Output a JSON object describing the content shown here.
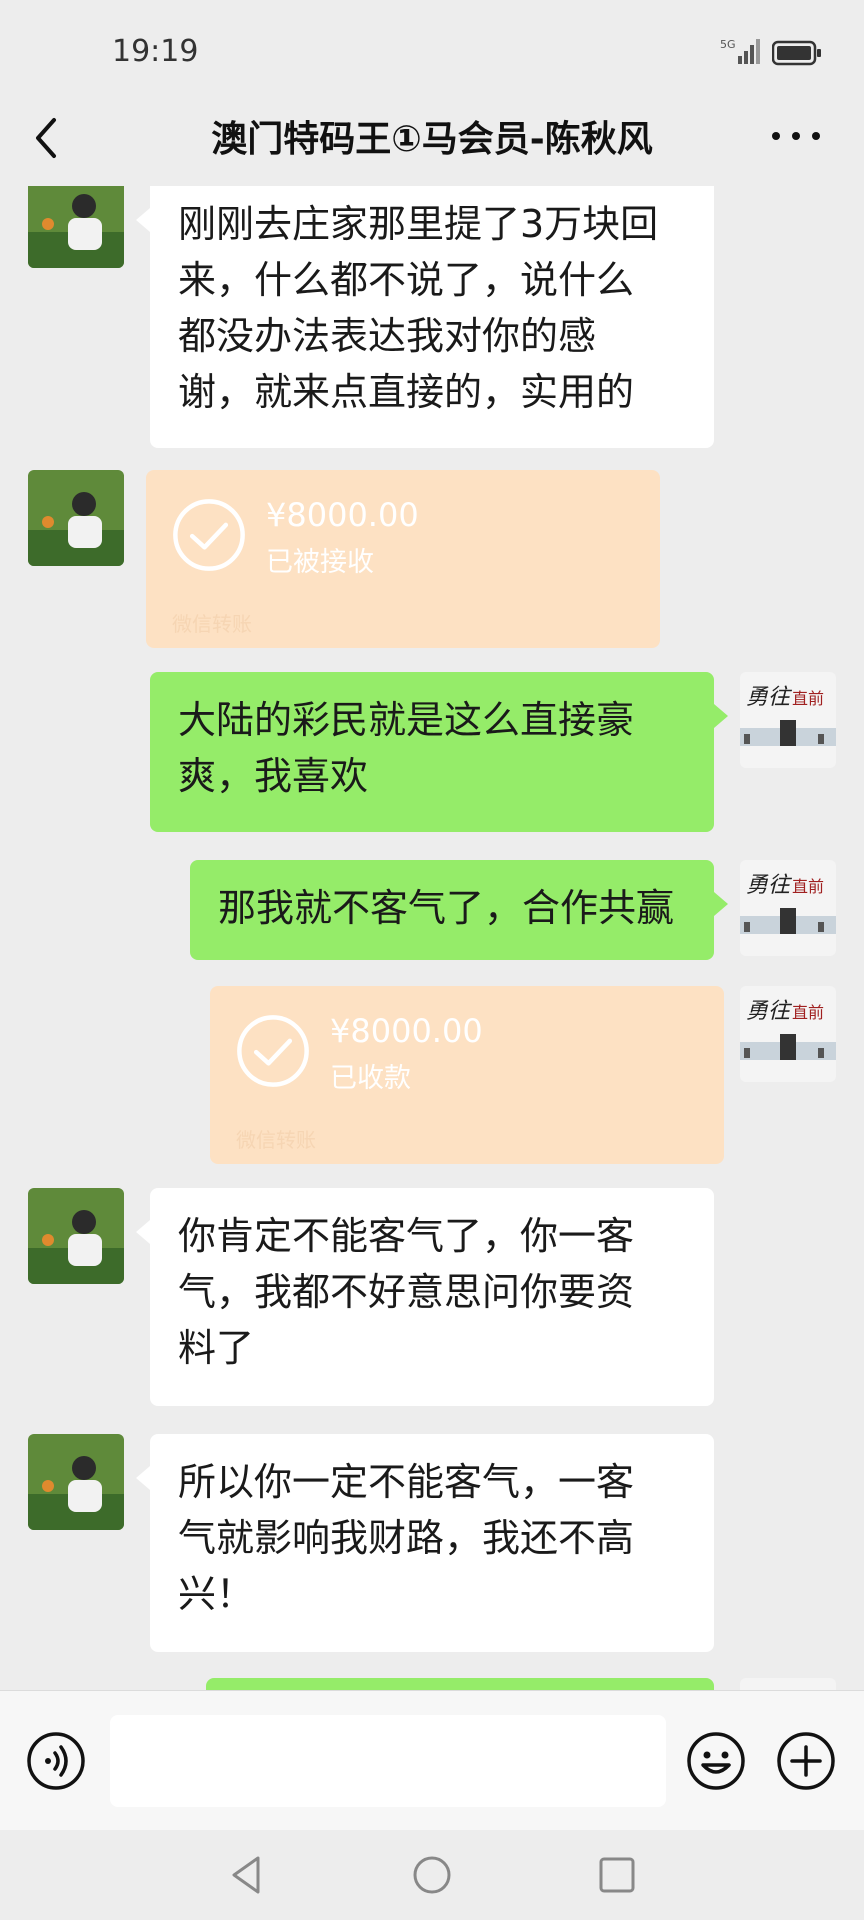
{
  "status_bar": {
    "time": "19:19",
    "network": "5G"
  },
  "header": {
    "title": "澳门特码王①马会员-陈秋风"
  },
  "messages": [
    {
      "side": "left",
      "type": "text",
      "lines": [
        "刚刚去庄家那里提了3万块回",
        "来，什么都不说了，说什么",
        "都没办法表达我对你的感",
        "谢，就来点直接的，实用的"
      ]
    },
    {
      "side": "left",
      "type": "transfer",
      "amount": "¥8000.00",
      "status": "已被接收",
      "footer": "微信转账"
    },
    {
      "side": "right",
      "type": "text",
      "lines": [
        "大陆的彩民就是这么直接豪",
        "爽，我喜欢"
      ]
    },
    {
      "side": "right",
      "type": "text",
      "lines": [
        "那我就不客气了，合作共赢"
      ]
    },
    {
      "side": "right",
      "type": "transfer",
      "amount": "¥8000.00",
      "status": "已收款",
      "footer": "微信转账"
    },
    {
      "side": "left",
      "type": "text",
      "lines": [
        "你肯定不能客气了，你一客",
        "气，我都不好意思问你要资",
        "料了"
      ]
    },
    {
      "side": "left",
      "type": "text",
      "lines": [
        "所以你一定不能客气，一客",
        "气就影响我财路，我还不高",
        "兴！"
      ]
    }
  ],
  "input_bar": {
    "placeholder": ""
  },
  "colors": {
    "background": "#ededed",
    "bubble_green": "#95ec69",
    "bubble_white": "#ffffff",
    "transfer_bg": "#fde1c3"
  },
  "icons": [
    "back-arrow-icon",
    "more-dots-icon",
    "voice-icon",
    "emoji-icon",
    "plus-icon",
    "nav-back-icon",
    "nav-home-icon",
    "nav-recent-icon"
  ]
}
